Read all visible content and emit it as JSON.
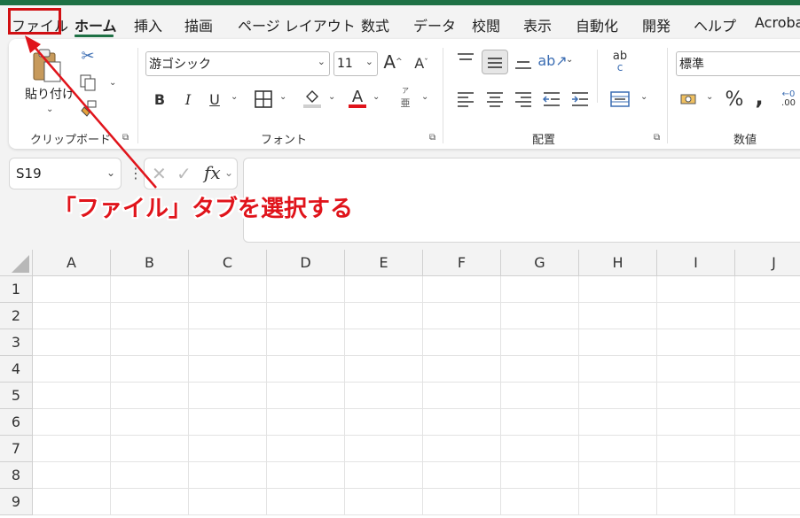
{
  "colors": {
    "accent": "#1e7145",
    "annotation": "#d10f12"
  },
  "tabs": [
    "ファイル",
    "ホーム",
    "挿入",
    "描画",
    "ページ レイアウト",
    "数式",
    "データ",
    "校閲",
    "表示",
    "自動化",
    "開発",
    "ヘルプ",
    "Acrobat"
  ],
  "active_tab": "ホーム",
  "ribbon": {
    "clipboard": {
      "paste_label": "貼り付け",
      "group_label": "クリップボード",
      "icons": [
        "paste-icon",
        "cut-icon",
        "copy-icon",
        "format-painter-icon"
      ]
    },
    "font": {
      "font_name": "游ゴシック",
      "font_size": "11",
      "grow_label": "A",
      "shrink_label": "A",
      "bold": "B",
      "italic": "I",
      "underline": "U",
      "font_color_label": "A",
      "phonetic_label": "亜",
      "phonetic_small": "ア",
      "group_label": "フォント"
    },
    "alignment": {
      "group_label": "配置",
      "wrap_label": "ab",
      "wrap_sub": "c"
    },
    "number": {
      "format": "標準",
      "percent": "%",
      "comma": ",",
      "dec_label": ".00",
      "group_label": "数値"
    }
  },
  "formula_bar": {
    "name_box": "S19",
    "fx": "fx"
  },
  "annotation": {
    "text": "「ファイル」タブを選択する"
  },
  "sheet": {
    "columns": [
      "A",
      "B",
      "C",
      "D",
      "E",
      "F",
      "G",
      "H",
      "I",
      "J"
    ],
    "rows": [
      "1",
      "2",
      "3",
      "4",
      "5",
      "6",
      "7",
      "8",
      "9"
    ]
  }
}
